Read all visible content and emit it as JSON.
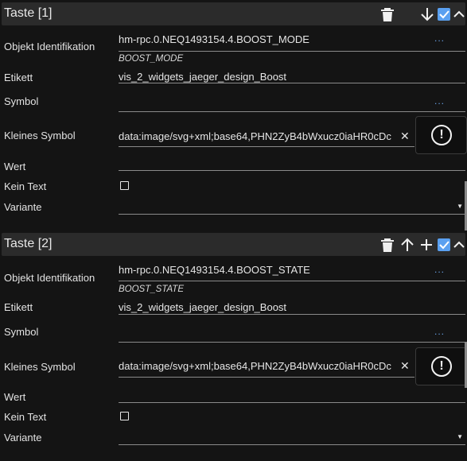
{
  "sections": [
    {
      "title": "Taste [1]",
      "fields": {
        "objekt_label": "Objekt Identifikation",
        "objekt_value": "hm-rpc.0.NEQ1493154.4.BOOST_MODE",
        "objekt_sub": "BOOST_MODE",
        "etikett_label": "Etikett",
        "etikett_value": "vis_2_widgets_jaeger_design_Boost",
        "symbol_label": "Symbol",
        "klein_label": "Kleines Symbol",
        "klein_value": "data:image/svg+xml;base64,PHN2ZyB4bWxucz0iaHR0cDc",
        "wert_label": "Wert",
        "keintext_label": "Kein Text",
        "variante_label": "Variante"
      }
    },
    {
      "title": "Taste [2]",
      "fields": {
        "objekt_label": "Objekt Identifikation",
        "objekt_value": "hm-rpc.0.NEQ1493154.4.BOOST_STATE",
        "objekt_sub": "BOOST_STATE",
        "etikett_label": "Etikett",
        "etikett_value": "vis_2_widgets_jaeger_design_Boost",
        "symbol_label": "Symbol",
        "klein_label": "Kleines Symbol",
        "klein_value": "data:image/svg+xml;base64,PHN2ZyB4bWxucz0iaHR0cDc",
        "wert_label": "Wert",
        "keintext_label": "Kein Text",
        "variante_label": "Variante"
      }
    }
  ],
  "ui": {
    "dots": "...",
    "clear_glyph": "✕",
    "excl_glyph": "!",
    "caret_glyph": "▼",
    "checkbox_checked": "✔"
  },
  "icons": [
    "trash-icon",
    "arrow-down-icon",
    "arrow-up-icon",
    "plus-icon",
    "checkbox-checked-icon",
    "chevron-up-icon",
    "alert-circle-icon"
  ],
  "colors": {
    "background": "#141414",
    "header": "#2b2b2b",
    "accent": "#5aa0f0",
    "underline": "#8a8a8a"
  }
}
